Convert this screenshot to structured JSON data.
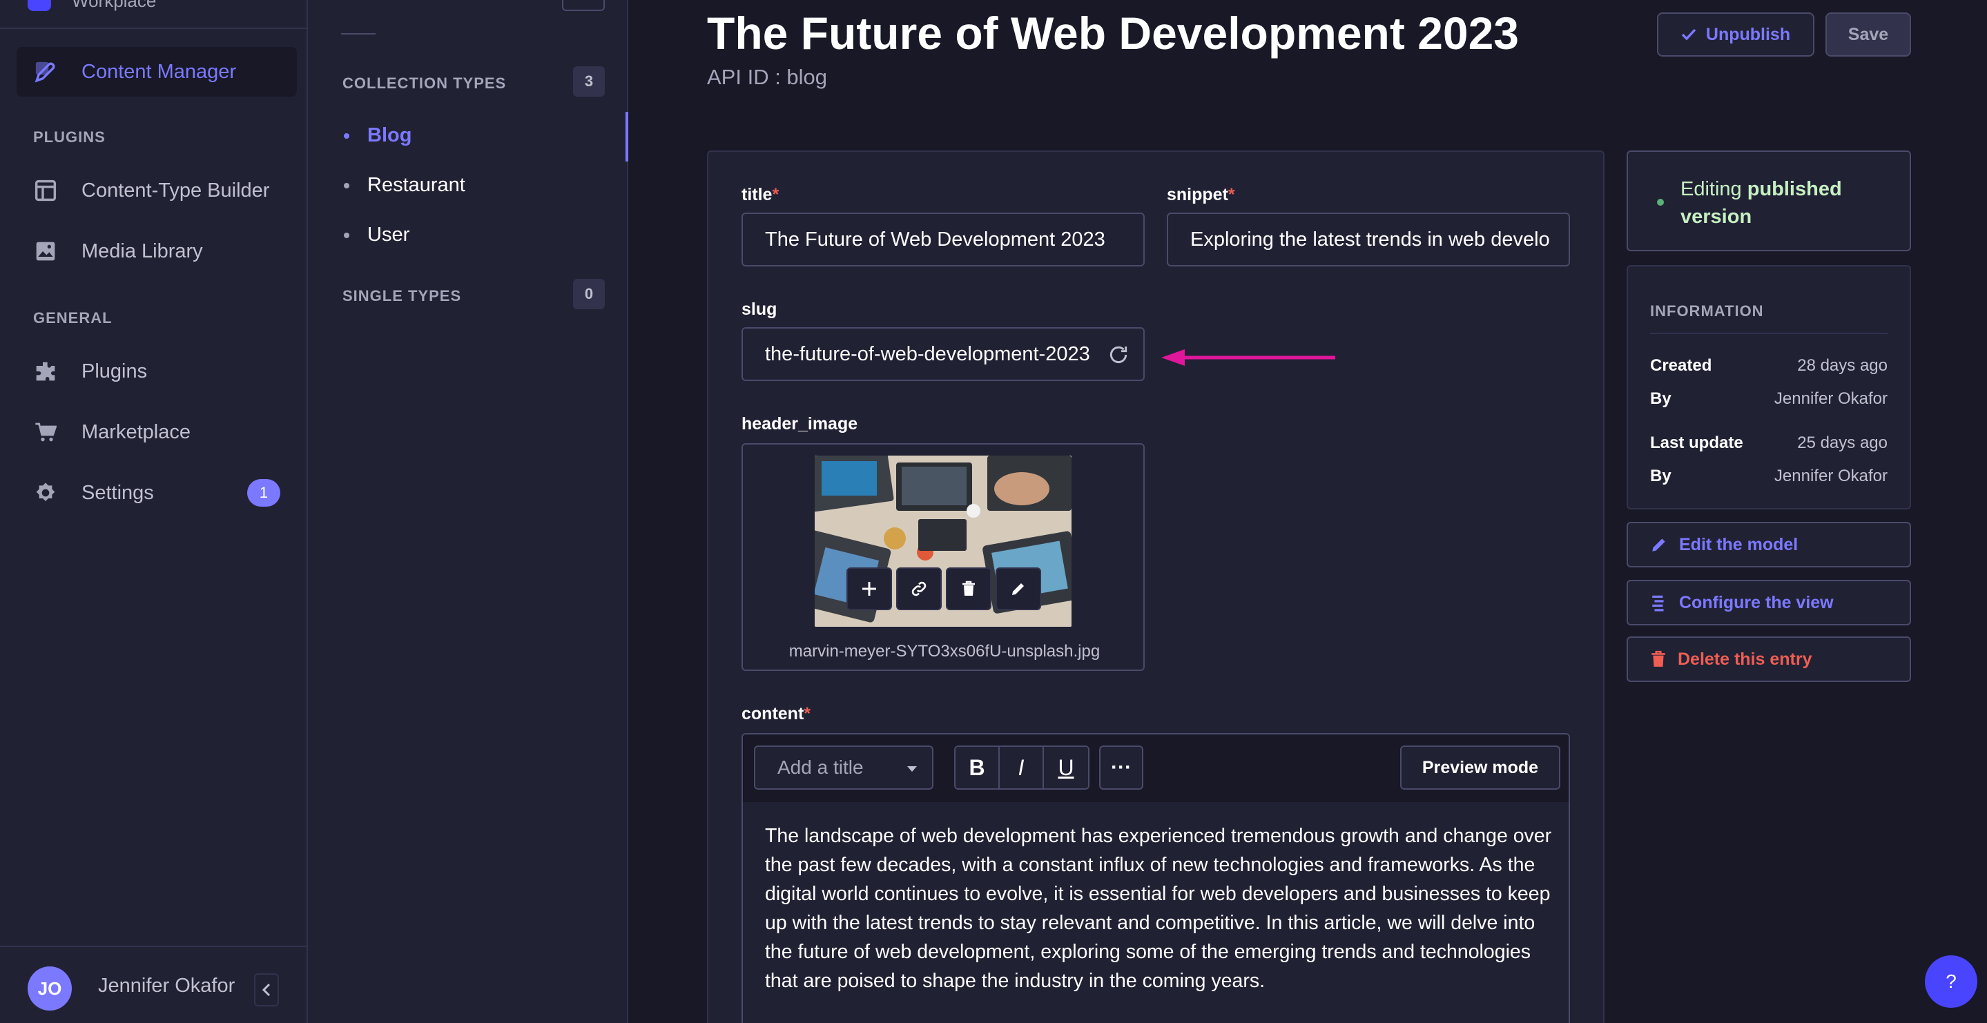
{
  "sidebar": {
    "workspace": "Workplace",
    "items": [
      {
        "label": "Content Manager",
        "icon": "feather-icon",
        "active": true
      },
      {
        "label": "Content-Type Builder",
        "icon": "layout-icon"
      },
      {
        "label": "Media Library",
        "icon": "images-icon"
      },
      {
        "label": "Plugins",
        "icon": "puzzle-icon"
      },
      {
        "label": "Marketplace",
        "icon": "cart-icon"
      },
      {
        "label": "Settings",
        "icon": "gear-icon",
        "badge": "1"
      }
    ],
    "sections": {
      "plugins": "PLUGINS",
      "general": "GENERAL"
    },
    "user": {
      "initials": "JO",
      "name": "Jennifer Okafor"
    }
  },
  "subnav": {
    "collection_types": {
      "label": "COLLECTION TYPES",
      "count": "3",
      "items": [
        "Blog",
        "Restaurant",
        "User"
      ]
    },
    "single_types": {
      "label": "SINGLE TYPES",
      "count": "0"
    }
  },
  "header": {
    "title": "The Future of Web Development 2023",
    "api_id": "API ID : blog",
    "unpublish_label": "Unpublish",
    "save_label": "Save"
  },
  "form": {
    "title": {
      "label": "title",
      "value": "The Future of Web Development 2023"
    },
    "snippet": {
      "label": "snippet",
      "value": "Exploring the latest trends in web development"
    },
    "slug": {
      "label": "slug",
      "value": "the-future-of-web-development-2023"
    },
    "header_image": {
      "label": "header_image",
      "filename": "marvin-meyer-SYTO3xs06fU-unsplash.jpg"
    },
    "content": {
      "label": "content",
      "heading_placeholder": "Add a title",
      "bold": "B",
      "italic": "I",
      "underline": "U",
      "more": "···",
      "preview_label": "Preview mode",
      "text": "The landscape of web development has experienced tremendous growth and change over the past few decades, with a constant influx of new technologies and frameworks. As the digital world continues to evolve, it is essential for web developers and businesses to keep up with the latest trends to stay relevant and competitive. In this article, we will delve into the future of web development, exploring some of the emerging trends and technologies that are poised to shape the industry in the coming years."
    }
  },
  "panel": {
    "status_prefix": "Editing ",
    "status_strong": "published version",
    "info_title": "INFORMATION",
    "created_label": "Created",
    "created_value": "28 days ago",
    "created_by_label": "By",
    "created_by_value": "Jennifer Okafor",
    "updated_label": "Last update",
    "updated_value": "25 days ago",
    "updated_by_label": "By",
    "updated_by_value": "Jennifer Okafor",
    "edit_model": "Edit the model",
    "configure_view": "Configure the view",
    "delete_entry": "Delete this entry"
  },
  "help": "?",
  "colors": {
    "accent": "#7b79ff",
    "danger": "#ee5e52",
    "success": "#5cb176",
    "annotation_arrow": "#e0179b"
  }
}
